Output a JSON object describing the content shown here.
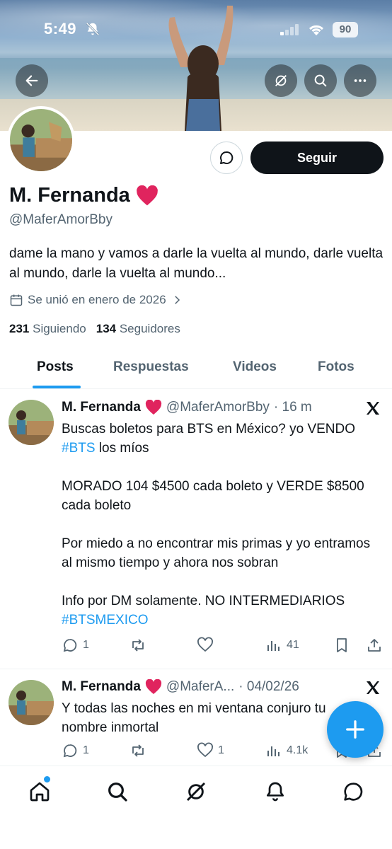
{
  "status_bar": {
    "time": "5:49",
    "battery": "90"
  },
  "profile": {
    "name": "M. Fernanda",
    "handle": "@MaferAmorBby",
    "bio": "dame la mano y vamos a darle la vuelta al mundo, darle vuelta al mundo, darle la vuelta al mundo...",
    "joined": "Se unió en enero de 2026",
    "following_count": "231",
    "following_label": "Siguiendo",
    "followers_count": "134",
    "followers_label": "Seguidores",
    "follow_label": "Seguir"
  },
  "tabs": [
    {
      "label": "Posts",
      "active": true
    },
    {
      "label": "Respuestas",
      "active": false
    },
    {
      "label": "Videos",
      "active": false
    },
    {
      "label": "Fotos",
      "active": false
    }
  ],
  "posts": [
    {
      "name": "M. Fernanda",
      "handle": "@MaferAmorBby",
      "time": "· 16 m",
      "line1": "Buscas boletos para BTS en México? yo VENDO",
      "tag1": "#BTS",
      "line2": " los míos",
      "para2": "MORADO 104 $4500 cada boleto y VERDE $8500 cada boleto",
      "para3": "Por miedo a no encontrar mis primas y yo entramos al mismo tiempo y ahora nos sobran",
      "para4": "Info por DM solamente. NO INTERMEDIARIOS",
      "tag2": "#BTSMEXICO",
      "replies": "1",
      "likes": "",
      "views": "41"
    },
    {
      "name": "M. Fernanda",
      "handle": "@MaferA...",
      "time": "· 04/02/26",
      "text": "Y todas las noches en mi ventana conjuro tu nombre inmortal",
      "replies": "1",
      "likes": "1",
      "views": "4.1k"
    }
  ],
  "colors": {
    "accent": "#1d9bf0",
    "text": "#0f1419",
    "muted": "#536471",
    "heart": "#e0245e"
  }
}
